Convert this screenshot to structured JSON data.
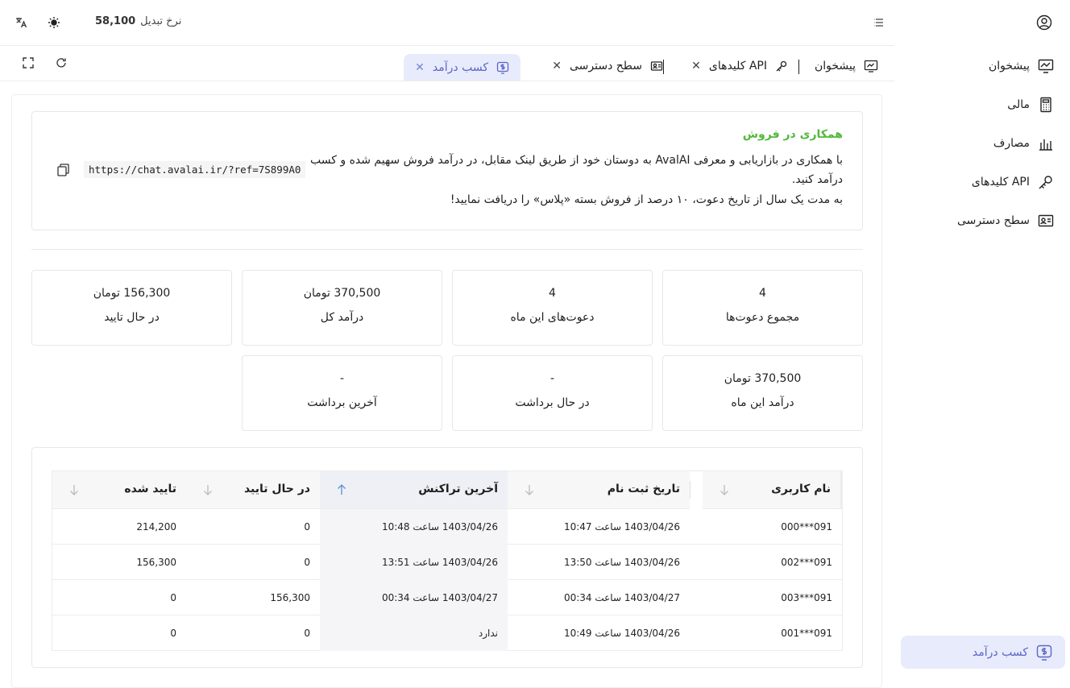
{
  "header": {
    "rate_label": "نرخ تبدیل",
    "rate_value": "58,100",
    "icons": [
      "translate-icon",
      "sun-icon",
      "menu-icon"
    ]
  },
  "sidebar": {
    "items": [
      {
        "label": "پیشخوان",
        "icon": "dashboard-icon"
      },
      {
        "label": "مالی",
        "icon": "calculator-icon"
      },
      {
        "label": "مصارف",
        "icon": "chart-icon"
      },
      {
        "label": "کلیدهای API",
        "icon": "key-icon"
      },
      {
        "label": "سطح دسترسی",
        "icon": "access-icon"
      }
    ],
    "active": {
      "label": "کسب درآمد",
      "icon": "dollar-icon"
    }
  },
  "tabs": [
    {
      "label": "پیشخوان"
    },
    {
      "label": "کلیدهای API"
    },
    {
      "label": "سطح دسترسی"
    },
    {
      "label": "کسب درآمد"
    }
  ],
  "affiliate": {
    "title": "همکاری در فروش",
    "description": "با همکاری در بازاریابی و معرفی AvalAI به دوستان خود از طریق لینک مقابل، در درآمد فروش سهیم شده و کسب درآمد کنید.",
    "description2": "به مدت یک سال از تاریخ دعوت، ۱۰ درصد از فروش بسته «پلاس» را دریافت نمایید!",
    "link": "https://chat.avalai.ir/?ref=7S899A0"
  },
  "stats": [
    {
      "value": "4",
      "label": "مجموع دعوت‌ها"
    },
    {
      "value": "4",
      "label": "دعوت‌های این ماه"
    },
    {
      "value": "370,500 تومان",
      "label": "درآمد کل"
    },
    {
      "value": "156,300 تومان",
      "label": "در حال تایید"
    },
    {
      "value": "370,500 تومان",
      "label": "درآمد این ماه"
    },
    {
      "value": "-",
      "label": "در حال برداشت"
    },
    {
      "value": "-",
      "label": "آخرین برداشت"
    }
  ],
  "table": {
    "columns": [
      "نام کاربری",
      "تاریخ ثبت نام",
      "آخرین تراکنش",
      "در حال تایید",
      "تایید شده"
    ],
    "rows": [
      [
        "091***000",
        "1403/04/26 ساعت 10:47",
        "1403/04/26 ساعت 10:48",
        "0",
        "214,200"
      ],
      [
        "091***002",
        "1403/04/26 ساعت 13:50",
        "1403/04/26 ساعت 13:51",
        "0",
        "156,300"
      ],
      [
        "091***003",
        "1403/04/27 ساعت 00:34",
        "1403/04/27 ساعت 00:34",
        "156,300",
        "0"
      ],
      [
        "091***001",
        "1403/04/26 ساعت 10:49",
        "ندارد",
        "0",
        "0"
      ]
    ]
  },
  "colors": {
    "accent": "#5b66c8",
    "accent_bg": "#e8ebfb",
    "title_green": "#52b83a"
  }
}
